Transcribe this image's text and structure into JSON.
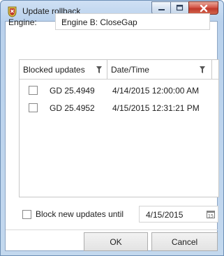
{
  "window": {
    "title": "Update rollback",
    "icon": "app-icon",
    "controls": [
      "minimize-icon",
      "maximize-icon",
      "close-icon"
    ]
  },
  "engine": {
    "label": "Engine:",
    "selected": "Engine B: CloseGap"
  },
  "table": {
    "columns": [
      "Blocked updates",
      "Date/Time"
    ],
    "rows": [
      {
        "checked": false,
        "update": "GD 25.4949",
        "datetime": "4/14/2015 12:00:00 AM"
      },
      {
        "checked": false,
        "update": "GD 25.4952",
        "datetime": "4/15/2015 12:31:21 PM"
      }
    ]
  },
  "block": {
    "checked": false,
    "label": "Block new updates until",
    "date": "4/15/2015"
  },
  "buttons": {
    "ok": "OK",
    "cancel": "Cancel"
  },
  "colors": {
    "title_bar": "#c3d8ee",
    "close_button": "#c9463a"
  }
}
